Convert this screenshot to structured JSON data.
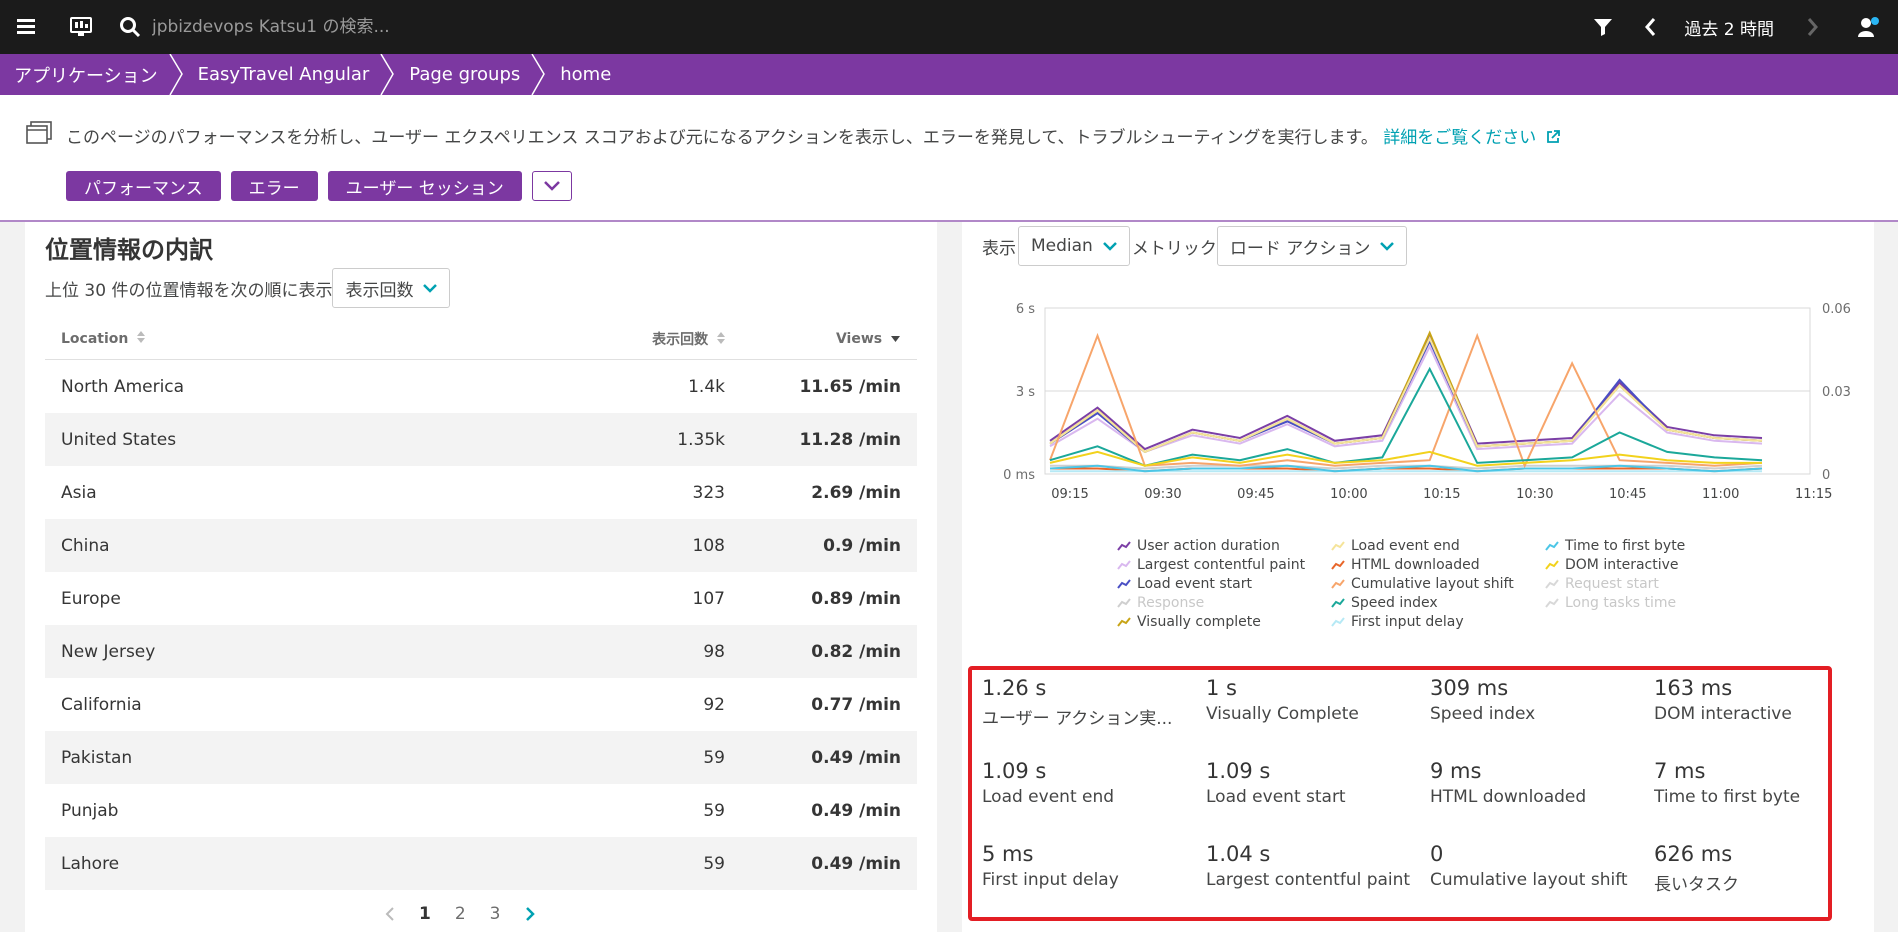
{
  "topbar": {
    "search_placeholder": "jpbizdevops Katsu1 の検索...",
    "time_range": "過去 2 時間"
  },
  "breadcrumb": [
    "アプリケーション",
    "EasyTravel Angular",
    "Page groups",
    "home"
  ],
  "info": {
    "text": "このページのパフォーマンスを分析し、ユーザー エクスペリエンス スコアおよび元になるアクションを表示し、エラーを発見して、トラブルシューティングを実行します。",
    "link": "詳細をご覧ください"
  },
  "tabs": [
    "パフォーマンス",
    "エラー",
    "ユーザー セッション"
  ],
  "location_panel": {
    "title": "位置情報の内訳",
    "sort_prefix": "上位 30 件の位置情報を次の順に表示",
    "sort_value": "表示回数",
    "columns": [
      "Location",
      "表示回数",
      "Views"
    ],
    "rows": [
      [
        "North America",
        "1.4k",
        "11.65 /min"
      ],
      [
        "United States",
        "1.35k",
        "11.28 /min"
      ],
      [
        "Asia",
        "323",
        "2.69 /min"
      ],
      [
        "China",
        "108",
        "0.9 /min"
      ],
      [
        "Europe",
        "107",
        "0.89 /min"
      ],
      [
        "New Jersey",
        "98",
        "0.82 /min"
      ],
      [
        "California",
        "92",
        "0.77 /min"
      ],
      [
        "Pakistan",
        "59",
        "0.49 /min"
      ],
      [
        "Punjab",
        "59",
        "0.49 /min"
      ],
      [
        "Lahore",
        "59",
        "0.49 /min"
      ]
    ],
    "pages": [
      "1",
      "2",
      "3"
    ]
  },
  "chart_panel": {
    "display_label": "表示",
    "display_value": "Median",
    "metric_label": "メトリック",
    "metric_value": "ロード アクション"
  },
  "chart_data": {
    "type": "line",
    "x": [
      "09:15",
      "09:30",
      "09:45",
      "10:00",
      "10:15",
      "10:30",
      "10:45",
      "11:00",
      "11:15"
    ],
    "y_left_ticks": [
      "6 s",
      "3 s",
      "0 ms"
    ],
    "y_right_ticks": [
      "0.06",
      "0.03",
      "0"
    ],
    "ylim": [
      0,
      6
    ],
    "series": [
      {
        "name": "User action duration",
        "color": "#7b3fa6",
        "values": [
          1.2,
          2.4,
          0.9,
          1.6,
          1.3,
          2.1,
          1.2,
          1.4,
          5.0,
          1.1,
          1.2,
          1.3,
          3.3,
          1.7,
          1.4,
          1.3
        ]
      },
      {
        "name": "Largest contentful paint",
        "color": "#d9b8ef",
        "values": [
          1.0,
          2.0,
          0.8,
          1.4,
          1.1,
          1.8,
          1.0,
          1.2,
          4.6,
          0.9,
          1.0,
          1.1,
          2.9,
          1.5,
          1.2,
          1.1
        ]
      },
      {
        "name": "Load event start",
        "color": "#4a4fc4",
        "values": [
          1.1,
          2.2,
          0.8,
          1.5,
          1.2,
          1.9,
          1.1,
          1.3,
          4.8,
          1.0,
          1.1,
          1.2,
          3.4,
          1.6,
          1.3,
          1.2
        ]
      },
      {
        "name": "Response",
        "color": "#cfcfcf",
        "values": [
          0.3,
          0.3,
          0.2,
          0.3,
          0.3,
          0.3,
          0.2,
          0.3,
          0.3,
          0.2,
          0.3,
          0.3,
          0.3,
          0.3,
          0.2,
          0.3
        ]
      },
      {
        "name": "Visually complete",
        "color": "#c8a416",
        "values": [
          1.1,
          2.3,
          0.8,
          1.5,
          1.2,
          2.0,
          1.1,
          1.3,
          5.1,
          1.0,
          1.1,
          1.2,
          3.2,
          1.6,
          1.3,
          1.2
        ]
      },
      {
        "name": "Load event end",
        "color": "#f5e49a",
        "values": [
          1.1,
          2.3,
          0.8,
          1.5,
          1.2,
          2.0,
          1.1,
          1.3,
          4.9,
          1.0,
          1.1,
          1.2,
          3.2,
          1.6,
          1.3,
          1.2
        ]
      },
      {
        "name": "HTML downloaded",
        "color": "#e8662a",
        "values": [
          0.2,
          0.2,
          0.1,
          0.2,
          0.2,
          0.2,
          0.1,
          0.2,
          0.2,
          0.1,
          0.2,
          0.2,
          0.2,
          0.2,
          0.1,
          0.2
        ]
      },
      {
        "name": "Cumulative layout shift",
        "color": "#f7a56b",
        "values": [
          0.5,
          5.0,
          0.3,
          0.4,
          0.3,
          0.5,
          0.3,
          0.4,
          0.5,
          5.0,
          0.3,
          4.0,
          0.5,
          0.4,
          0.3,
          0.4
        ]
      },
      {
        "name": "Speed index",
        "color": "#1ba89a",
        "values": [
          0.5,
          1.0,
          0.3,
          0.7,
          0.5,
          0.9,
          0.4,
          0.6,
          3.8,
          0.4,
          0.5,
          0.6,
          1.5,
          0.8,
          0.6,
          0.5
        ]
      },
      {
        "name": "First input delay",
        "color": "#b6e9f5",
        "values": [
          0.1,
          0.1,
          0.1,
          0.1,
          0.1,
          0.1,
          0.1,
          0.1,
          0.1,
          0.1,
          0.1,
          0.1,
          0.1,
          0.1,
          0.1,
          0.1
        ]
      },
      {
        "name": "Time to first byte",
        "color": "#4cc6e6",
        "values": [
          0.2,
          0.3,
          0.1,
          0.2,
          0.2,
          0.3,
          0.1,
          0.2,
          0.3,
          0.1,
          0.2,
          0.2,
          0.3,
          0.2,
          0.1,
          0.2
        ]
      },
      {
        "name": "DOM interactive",
        "color": "#f2d21c",
        "values": [
          0.4,
          0.8,
          0.3,
          0.6,
          0.4,
          0.7,
          0.4,
          0.5,
          0.8,
          0.3,
          0.4,
          0.5,
          0.7,
          0.5,
          0.4,
          0.4
        ]
      },
      {
        "name": "Request start",
        "color": "#d8d8d8",
        "values": []
      },
      {
        "name": "Long tasks time",
        "color": "#d8d8d8",
        "values": []
      }
    ],
    "dim_series": [
      "Response",
      "Request start",
      "Long tasks time"
    ]
  },
  "metrics": [
    {
      "value": "1.26 s",
      "label": "ユーザー アクション実..."
    },
    {
      "value": "1 s",
      "label": "Visually Complete"
    },
    {
      "value": "309 ms",
      "label": "Speed index"
    },
    {
      "value": "163 ms",
      "label": "DOM interactive"
    },
    {
      "value": "1.09 s",
      "label": "Load event end"
    },
    {
      "value": "1.09 s",
      "label": "Load event start"
    },
    {
      "value": "9 ms",
      "label": "HTML downloaded"
    },
    {
      "value": "7 ms",
      "label": "Time to first byte"
    },
    {
      "value": "5 ms",
      "label": "First input delay"
    },
    {
      "value": "1.04 s",
      "label": "Largest contentful paint"
    },
    {
      "value": "0",
      "label": "Cumulative layout shift"
    },
    {
      "value": "626 ms",
      "label": "長いタスク"
    }
  ]
}
